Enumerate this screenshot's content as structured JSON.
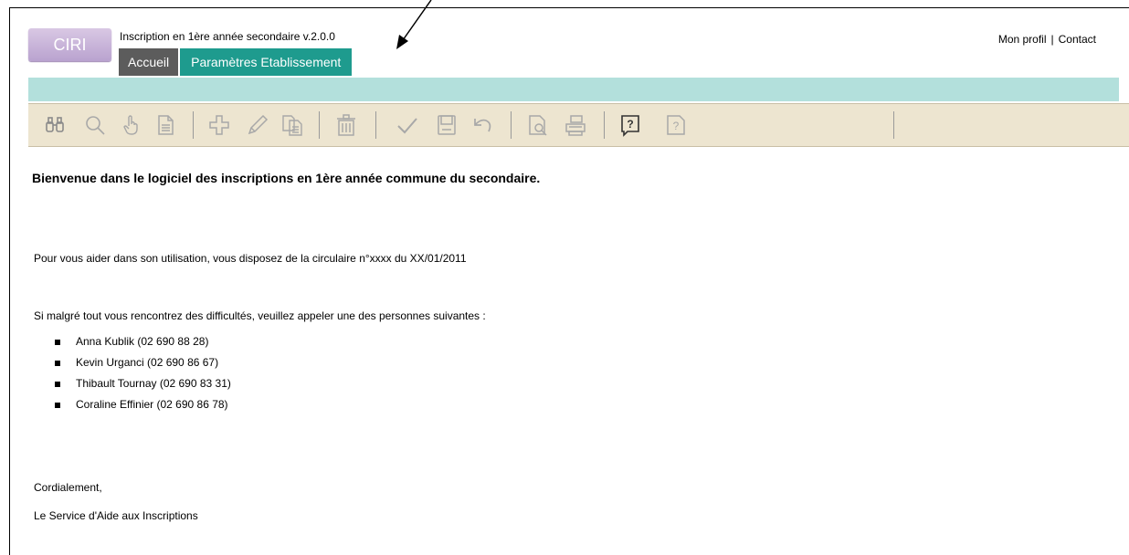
{
  "header": {
    "logo_text": "CIRI",
    "app_title": "Inscription en 1ère année secondaire v.2.0.0",
    "nav": {
      "home_label": "Accueil",
      "settings_label": "Paramètres Etablissement"
    },
    "links": {
      "profile": "Mon profil",
      "separator": "|",
      "contact": "Contact"
    }
  },
  "toolbar": {
    "icons": [
      "binoculars-icon",
      "magnifier-icon",
      "pointing-hand-icon",
      "document-icon",
      "plus-icon",
      "pencil-icon",
      "copy-document-icon",
      "trash-icon",
      "checkmark-icon",
      "save-icon",
      "undo-icon",
      "print-preview-icon",
      "printer-icon",
      "help-active-icon",
      "help-inactive-icon"
    ]
  },
  "content": {
    "welcome": "Bienvenue dans le logiciel des inscriptions en 1ère année commune du secondaire.",
    "help_text": "Pour vous aider dans son utilisation, vous disposez de la circulaire n°xxxx du XX/01/2011",
    "difficulty_text": "Si malgré tout vous rencontrez des difficultés, veuillez appeler une des personnes suivantes :",
    "contacts": [
      "Anna Kublik (02 690 88 28)",
      "Kevin Urganci (02 690 86 67)",
      "Thibault Tournay (02 690 83 31)",
      "Coraline Effinier (02 690 86 78)"
    ],
    "closing": "Cordialement,",
    "signature": "Le Service d'Aide aux Inscriptions"
  },
  "colors": {
    "logo": "#c6b3d9",
    "nav_home": "#5c5c5c",
    "nav_settings": "#1e9b8e",
    "teal_bar": "#b3e0dc",
    "toolbar": "#ede5d0"
  }
}
